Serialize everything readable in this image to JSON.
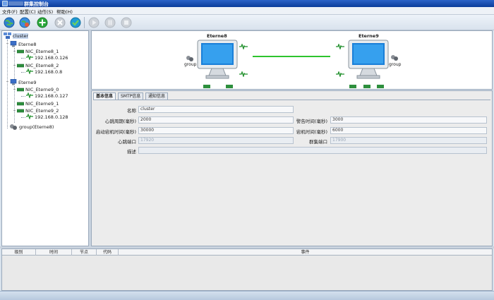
{
  "window": {
    "title": "群集控制台"
  },
  "menu": [
    "文件(F)",
    "配置(C)",
    "动作(S)",
    "帮助(H)"
  ],
  "toolbar": {
    "buttons": [
      {
        "name": "connect-globe",
        "color": "#2e7fd1"
      },
      {
        "name": "refresh-globe",
        "color": "#3a8de0"
      },
      {
        "name": "add",
        "color": "#2aa83c"
      },
      {
        "name": "delete",
        "color": "#c0c6ce"
      },
      {
        "name": "check",
        "color": "#1f9bd6"
      },
      {
        "name": "play",
        "color": "#c7ccd3"
      },
      {
        "name": "pause",
        "color": "#c7ccd3"
      },
      {
        "name": "stop",
        "color": "#c7ccd3"
      }
    ]
  },
  "tree": {
    "root": "cluster",
    "nodes": [
      {
        "label": "Eterne8",
        "nics": [
          {
            "label": "NIC_Eterne8_1",
            "ip": "192.168.0.126"
          },
          {
            "label": "NIC_Eterne8_2",
            "ip": "192.168.0.8"
          }
        ]
      },
      {
        "label": "Eterne9",
        "nics": [
          {
            "label": "NIC_Eterne9_0",
            "ip": "192.168.0.127"
          },
          {
            "label": "NIC_Eterne9_1",
            "ip": ""
          },
          {
            "label": "NIC_Eterne9_2",
            "ip": "192.168.0.128"
          }
        ]
      }
    ],
    "group": "group(Eterne8)"
  },
  "topology": {
    "hosts": [
      {
        "name": "Eterne8",
        "group_label": "group"
      },
      {
        "name": "Eterne9",
        "group_label": "group"
      }
    ],
    "link_color": "#2ec42e"
  },
  "tabs": [
    "基本信息",
    "SMTP信息",
    "通知信息"
  ],
  "form": {
    "name_label": "名称",
    "name_value": "cluster",
    "heartbeat_label": "心跳周期(毫秒)",
    "heartbeat_value": "2000",
    "warning_label": "警告时间(毫秒)",
    "warning_value": "3000",
    "startup_label": "启动宕机时间(毫秒)",
    "startup_value": "30000",
    "down_label": "宕机时间(毫秒)",
    "down_value": "6000",
    "hb_port_label": "心跳端口",
    "hb_port_value": "17920",
    "cluster_port_label": "群集端口",
    "cluster_port_value": "17900",
    "desc_label": "描述",
    "desc_value": ""
  },
  "log": {
    "columns": [
      "级别",
      "时间",
      "节点",
      "代码",
      "事件"
    ]
  }
}
